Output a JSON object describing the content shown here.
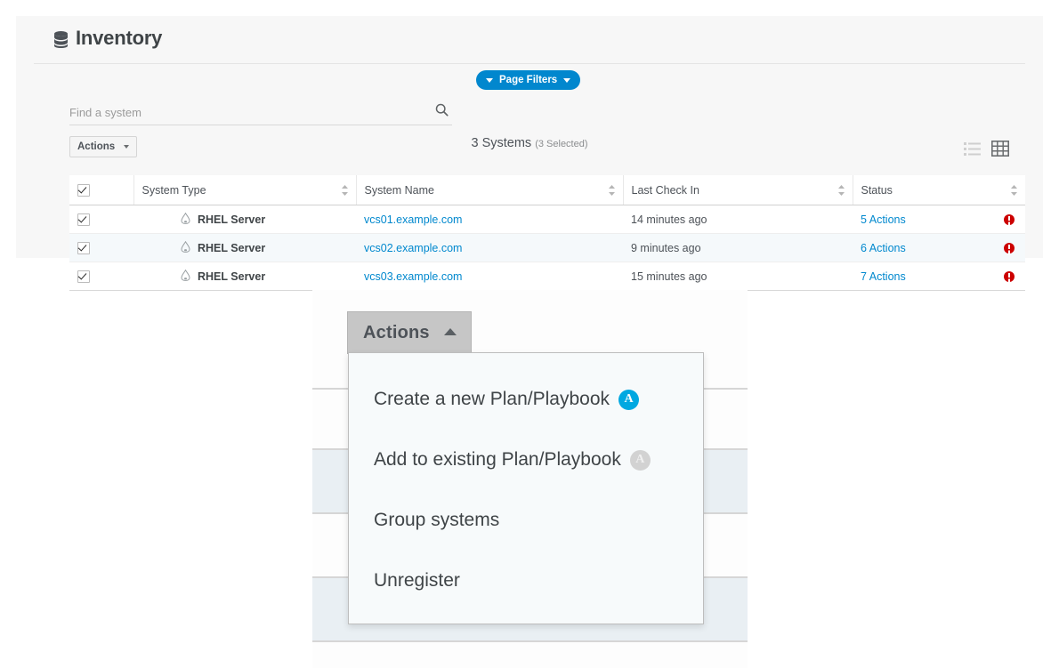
{
  "app": {
    "title": "Inventory",
    "title_icon": "database-icon",
    "page_filters": {
      "label": "Page Filters",
      "left_icon": "caret-down-icon",
      "right_icon": "caret-down-icon",
      "color": "#0187ce"
    },
    "search": {
      "placeholder": "Find a system",
      "value": "",
      "icon": "search-icon"
    },
    "actions_button": {
      "label": "Actions",
      "icon": "caret-down-icon"
    },
    "systems_count": {
      "count_label": "3 Systems",
      "selected_label": "(3 Selected)"
    },
    "view_toggles": [
      {
        "name": "list-view-icon",
        "active": false
      },
      {
        "name": "grid-view-icon",
        "active": true
      }
    ]
  },
  "table": {
    "select_all_checked": true,
    "columns": [
      {
        "label": "",
        "sortable": false
      },
      {
        "label": "System Type",
        "sortable": true
      },
      {
        "label": "System Name",
        "sortable": true
      },
      {
        "label": "Last Check In",
        "sortable": true
      },
      {
        "label": "Status",
        "sortable": true
      }
    ],
    "rows": [
      {
        "checked": true,
        "system_type": "RHEL Server",
        "system_name": "vcs01.example.com",
        "last_check_in": "14 minutes ago",
        "status": "5 Actions",
        "status_icon": "error-circle-icon"
      },
      {
        "checked": true,
        "system_type": "RHEL Server",
        "system_name": "vcs02.example.com",
        "last_check_in": "9 minutes ago",
        "status": "6 Actions",
        "status_icon": "error-circle-icon"
      },
      {
        "checked": true,
        "system_type": "RHEL Server",
        "system_name": "vcs03.example.com",
        "last_check_in": "15 minutes ago",
        "status": "7 Actions",
        "status_icon": "error-circle-icon"
      }
    ]
  },
  "zoom_inset": {
    "actions_button": {
      "label": "Actions",
      "icon": "caret-up-icon"
    },
    "menu_items": [
      {
        "label": "Create a new Plan/Playbook",
        "badge": "ansible-icon",
        "badge_text": "A",
        "badge_disabled": false
      },
      {
        "label": "Add to existing Plan/Playbook",
        "badge": "ansible-icon",
        "badge_text": "A",
        "badge_disabled": true
      },
      {
        "label": "Group systems",
        "badge": null,
        "badge_text": "",
        "badge_disabled": false
      },
      {
        "label": "Unregister",
        "badge": null,
        "badge_text": "",
        "badge_disabled": false
      }
    ]
  },
  "colors": {
    "accent_blue": "#0088ce",
    "pill_blue": "#0187ce",
    "ansible_blue": "#00a8e1",
    "error_red": "#cc0000",
    "panel_bg": "#f7f7f7"
  }
}
